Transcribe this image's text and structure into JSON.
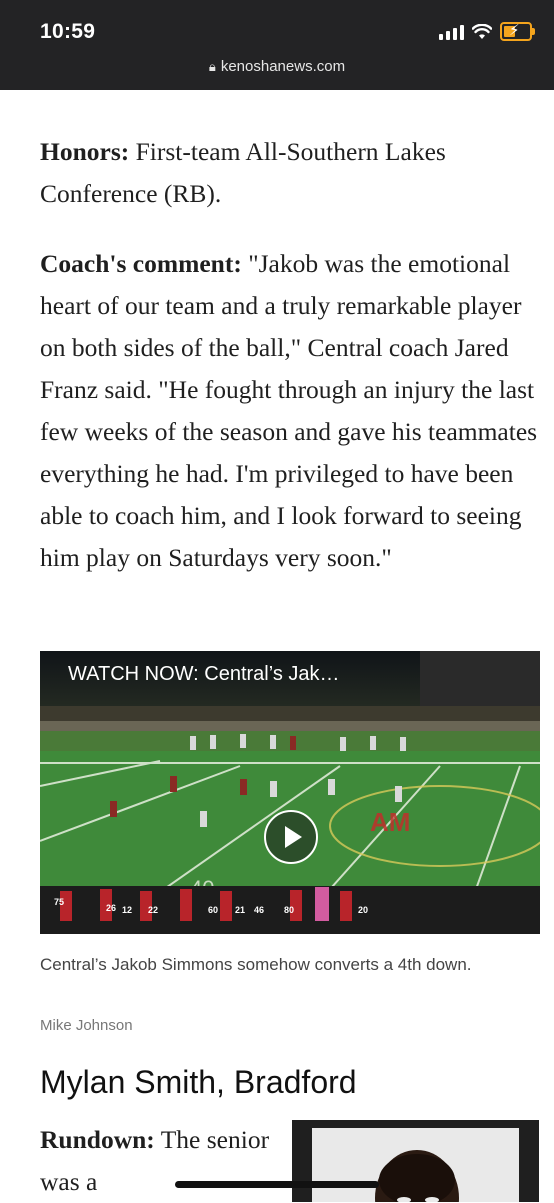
{
  "status_bar": {
    "time": "10:59"
  },
  "browser": {
    "url": "kenoshanews.com",
    "lock_icon": "lock-icon"
  },
  "article": {
    "honors_label": "Honors:",
    "honors_text": "First-team All-Southern Lakes Conference (RB).",
    "coach_label": "Coach's comment:",
    "coach_text": "\"Jakob was the emotional heart of our team and a truly remarkable player on both sides of the ball,\" Central coach Jared Franz said. \"He fought through an injury the last few weeks of the season and gave his teammates everything he had. I'm privileged to have been able to coach him, and I look forward to seeing him play on Saturdays very soon.\"",
    "video": {
      "title": "WATCH NOW: Central’s Jak…",
      "play_icon": "play-icon"
    },
    "caption": "Central’s Jakob Simmons somehow converts a 4th down.",
    "credit": "Mike Johnson",
    "section_heading": "Mylan Smith, Bradford",
    "rundown_label": "Rundown:",
    "rundown_text": "The senior was a"
  },
  "colors": {
    "status_bar_bg": "#232325",
    "battery": "#f4a41d",
    "field_green": "#3f8a3a"
  }
}
